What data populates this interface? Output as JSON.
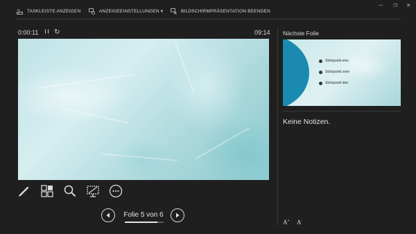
{
  "toolbar": {
    "taskbar_label": "TASKLEISTE ANZEIGEN",
    "display_settings_label": "ANZEIGEEINSTELLUNGEN ▾",
    "end_show_label": "BILDSCHIRMPRÄSENTATION BEENDEN"
  },
  "window": {
    "minimize": "—",
    "restore": "❐",
    "close": "✕"
  },
  "timer": {
    "elapsed": "0:00:11",
    "pause_icon": "❙❙",
    "reset_icon": "↻",
    "clock": "09:14"
  },
  "navigation": {
    "slide_counter": "Folie 5 von 6",
    "current": 5,
    "total": 6,
    "progress": 0.833
  },
  "next_slide": {
    "label": "Nächste Folie",
    "bullets": [
      "Stichpunkt eins",
      "Stichpunkt zwei",
      "Stichpunkt drei"
    ],
    "accent_color": "#1a8ab0"
  },
  "notes": {
    "text": "Keine Notizen."
  },
  "font_controls": {
    "increase_label": "A",
    "increase_sup": "+",
    "decrease_label": "A",
    "decrease_sup": "-"
  },
  "tools": {
    "pen": "pen-icon",
    "slides": "see-all-slides-icon",
    "zoom": "zoom-icon",
    "screen": "black-screen-icon",
    "more": "more-options-icon"
  }
}
